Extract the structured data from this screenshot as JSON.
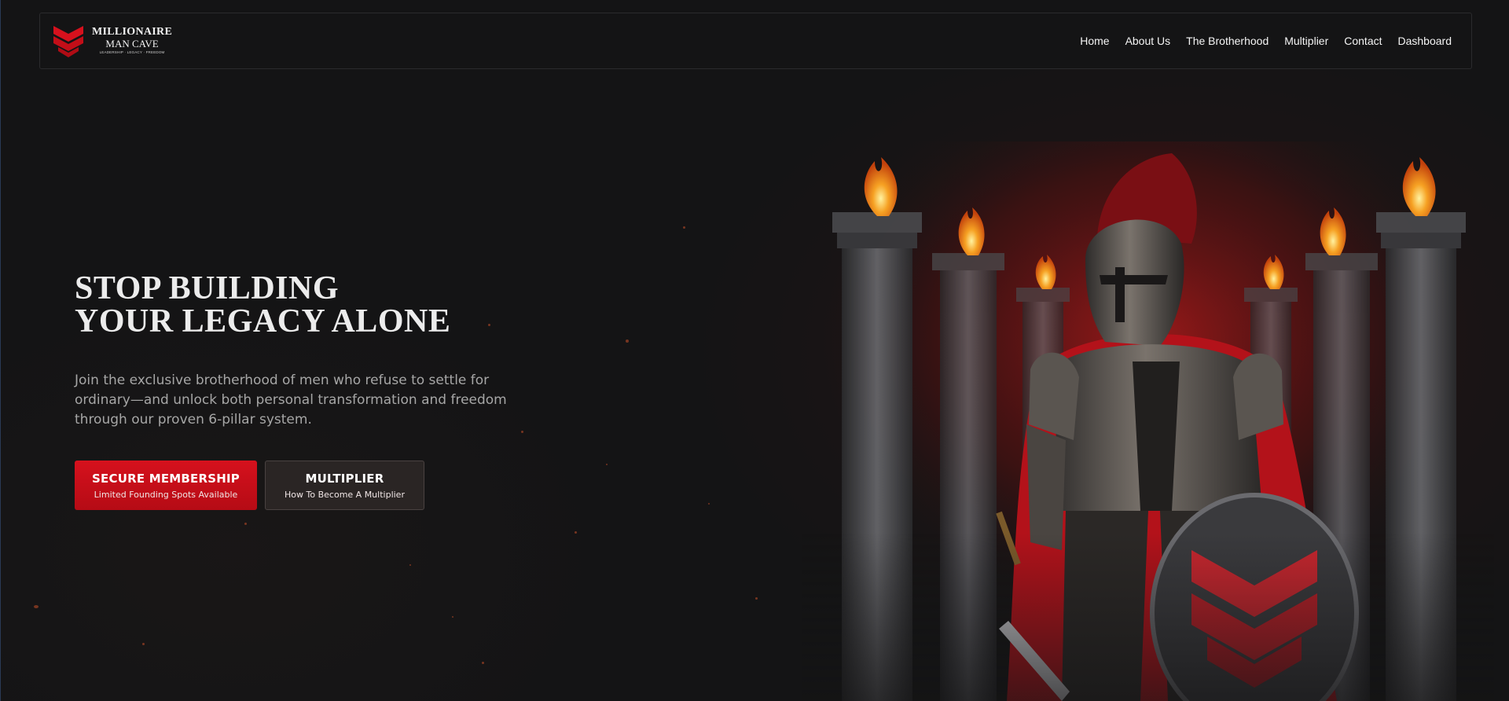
{
  "brand": {
    "line1": "MILLIONAIRE",
    "line2": "MAN CAVE",
    "tagline": "LEADERSHIP · LEGACY · FREEDOM",
    "accent": "#d6111d"
  },
  "nav": {
    "items": [
      {
        "label": "Home"
      },
      {
        "label": "About Us"
      },
      {
        "label": "The Brotherhood"
      },
      {
        "label": "Multiplier"
      },
      {
        "label": "Contact"
      },
      {
        "label": "Dashboard"
      }
    ]
  },
  "hero": {
    "title_line1": "STOP BUILDING",
    "title_line2": "YOUR LEGACY ALONE",
    "description": "Join the exclusive brotherhood of men who refuse to settle for ordinary—and unlock both personal transformation and freedom through our proven 6-pillar system.",
    "primary_cta": {
      "label": "SECURE MEMBERSHIP",
      "sublabel": "Limited Founding Spots Available"
    },
    "secondary_cta": {
      "label": "MULTIPLIER",
      "sublabel": "How To Become A Multiplier"
    }
  },
  "colors": {
    "background": "#141415",
    "primary_button": "#d6111d",
    "secondary_button": "#2a2524",
    "flame": "#f08a1c"
  }
}
